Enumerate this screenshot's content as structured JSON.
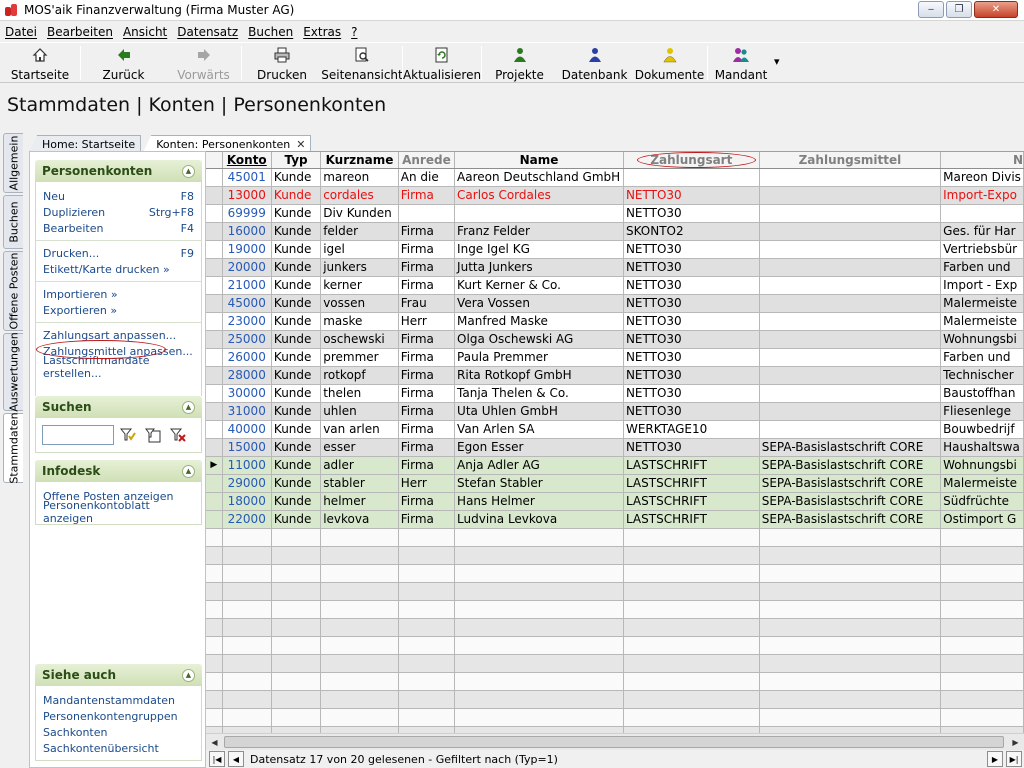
{
  "window": {
    "title": "MOS'aik Finanzverwaltung (Firma Muster AG)",
    "buttons": {
      "minimize": "‒",
      "maximize": "❐",
      "close": "✕"
    }
  },
  "menu": [
    "Datei",
    "Bearbeiten",
    "Ansicht",
    "Datensatz",
    "Buchen",
    "Extras",
    "?"
  ],
  "toolbar": {
    "startseite": "Startseite",
    "zurueck": "Zurück",
    "vorwaerts": "Vorwärts",
    "drucken": "Drucken",
    "seitenansicht": "Seitenansicht",
    "aktualisieren": "Aktualisieren",
    "projekte": "Projekte",
    "datenbank": "Datenbank",
    "dokumente": "Dokumente",
    "mandant": "Mandant",
    "more_arrow": "▾"
  },
  "heading": "Stammdaten | Konten | Personenkonten",
  "vertical_tabs": [
    "Allgemein",
    "Buchen",
    "Offene Posten",
    "Auswertungen",
    "Stammdaten"
  ],
  "doc_tabs": {
    "home": "Home: Startseite",
    "konten": "Konten: Personenkonten",
    "close": "✕"
  },
  "task_panel": {
    "personenkonten": {
      "title": "Personenkonten",
      "items": [
        {
          "label": "Neu",
          "shortcut": "F8"
        },
        {
          "label": "Duplizieren",
          "shortcut": "Strg+F8"
        },
        {
          "label": "Bearbeiten",
          "shortcut": "F4"
        },
        {
          "label": "Drucken...",
          "shortcut": "F9"
        },
        {
          "label": "Etikett/Karte drucken »",
          "shortcut": ""
        },
        {
          "label": "Importieren »",
          "shortcut": ""
        },
        {
          "label": "Exportieren »",
          "shortcut": ""
        },
        {
          "label": "Zahlungsart anpassen...",
          "shortcut": ""
        },
        {
          "label": "Zahlungsmittel anpassen...",
          "shortcut": ""
        },
        {
          "label": "Lastschriftmandate erstellen...",
          "shortcut": ""
        }
      ]
    },
    "suchen": {
      "title": "Suchen",
      "value": ""
    },
    "infodesk": {
      "title": "Infodesk",
      "items": [
        "Offene Posten anzeigen",
        "Personenkontoblatt anzeigen"
      ]
    },
    "siehe_auch": {
      "title": "Siehe auch",
      "items": [
        "Mandantenstammdaten",
        "Personenkontengruppen",
        "Sachkonten",
        "Sachkontenübersicht"
      ]
    }
  },
  "grid": {
    "columns": [
      "Konto",
      "Typ",
      "Kurzname",
      "Anrede",
      "Name",
      "Zahlungsart",
      "Zahlungsmittel",
      "N"
    ],
    "rows": [
      {
        "konto": "45001",
        "typ": "Kunde",
        "kurzname": "mareon",
        "anrede": "An die",
        "name": "Aareon Deutschland GmbH",
        "zahlungsart": "",
        "zahlungsmittel": "",
        "n": "Mareon Divis",
        "style": "white"
      },
      {
        "konto": "13000",
        "typ": "Kunde",
        "kurzname": "cordales",
        "anrede": "Firma",
        "name": "Carlos Cordales",
        "zahlungsart": "NETTO30",
        "zahlungsmittel": "",
        "n": "Import-Expo",
        "style": "gray",
        "red": true
      },
      {
        "konto": "69999",
        "typ": "Kunde",
        "kurzname": "Div Kunden",
        "anrede": "",
        "name": "",
        "zahlungsart": "NETTO30",
        "zahlungsmittel": "",
        "n": "",
        "style": "white"
      },
      {
        "konto": "16000",
        "typ": "Kunde",
        "kurzname": "felder",
        "anrede": "Firma",
        "name": "Franz Felder",
        "zahlungsart": "SKONTO2",
        "zahlungsmittel": "",
        "n": "Ges. für Har",
        "style": "gray"
      },
      {
        "konto": "19000",
        "typ": "Kunde",
        "kurzname": "igel",
        "anrede": "Firma",
        "name": "Inge Igel KG",
        "zahlungsart": "NETTO30",
        "zahlungsmittel": "",
        "n": "Vertriebsbür",
        "style": "white"
      },
      {
        "konto": "20000",
        "typ": "Kunde",
        "kurzname": "junkers",
        "anrede": "Firma",
        "name": "Jutta Junkers",
        "zahlungsart": "NETTO30",
        "zahlungsmittel": "",
        "n": "Farben und",
        "style": "gray"
      },
      {
        "konto": "21000",
        "typ": "Kunde",
        "kurzname": "kerner",
        "anrede": "Firma",
        "name": "Kurt Kerner & Co.",
        "zahlungsart": "NETTO30",
        "zahlungsmittel": "",
        "n": "Import - Exp",
        "style": "white"
      },
      {
        "konto": "45000",
        "typ": "Kunde",
        "kurzname": "vossen",
        "anrede": "Frau",
        "name": "Vera Vossen",
        "zahlungsart": "NETTO30",
        "zahlungsmittel": "",
        "n": "Malermeiste",
        "style": "gray"
      },
      {
        "konto": "23000",
        "typ": "Kunde",
        "kurzname": "maske",
        "anrede": "Herr",
        "name": "Manfred Maske",
        "zahlungsart": "NETTO30",
        "zahlungsmittel": "",
        "n": "Malermeiste",
        "style": "white"
      },
      {
        "konto": "25000",
        "typ": "Kunde",
        "kurzname": "oschewski",
        "anrede": "Firma",
        "name": "Olga Oschewski AG",
        "zahlungsart": "NETTO30",
        "zahlungsmittel": "",
        "n": "Wohnungsbi",
        "style": "gray"
      },
      {
        "konto": "26000",
        "typ": "Kunde",
        "kurzname": "premmer",
        "anrede": "Firma",
        "name": "Paula Premmer",
        "zahlungsart": "NETTO30",
        "zahlungsmittel": "",
        "n": "Farben und",
        "style": "white"
      },
      {
        "konto": "28000",
        "typ": "Kunde",
        "kurzname": "rotkopf",
        "anrede": "Firma",
        "name": "Rita Rotkopf GmbH",
        "zahlungsart": "NETTO30",
        "zahlungsmittel": "",
        "n": "Technischer",
        "style": "gray"
      },
      {
        "konto": "30000",
        "typ": "Kunde",
        "kurzname": "thelen",
        "anrede": "Firma",
        "name": "Tanja Thelen & Co.",
        "zahlungsart": "NETTO30",
        "zahlungsmittel": "",
        "n": "Baustoffhan",
        "style": "white"
      },
      {
        "konto": "31000",
        "typ": "Kunde",
        "kurzname": "uhlen",
        "anrede": "Firma",
        "name": "Uta Uhlen GmbH",
        "zahlungsart": "NETTO30",
        "zahlungsmittel": "",
        "n": "Fliesenlege",
        "style": "gray"
      },
      {
        "konto": "40000",
        "typ": "Kunde",
        "kurzname": "van arlen",
        "anrede": "Firma",
        "name": "Van Arlen SA",
        "zahlungsart": "WERKTAGE10",
        "zahlungsmittel": "",
        "n": "Bouwbedrijf",
        "style": "white"
      },
      {
        "konto": "15000",
        "typ": "Kunde",
        "kurzname": "esser",
        "anrede": "Firma",
        "name": "Egon Esser",
        "zahlungsart": "NETTO30",
        "zahlungsmittel": "SEPA-Basislastschrift CORE",
        "n": "Haushaltswa",
        "style": "gray"
      },
      {
        "konto": "11000",
        "typ": "Kunde",
        "kurzname": "adler",
        "anrede": "Firma",
        "name": "Anja Adler AG",
        "zahlungsart": "LASTSCHRIFT",
        "zahlungsmittel": "SEPA-Basislastschrift CORE",
        "n": "Wohnungsbi",
        "style": "green",
        "current": true
      },
      {
        "konto": "29000",
        "typ": "Kunde",
        "kurzname": "stabler",
        "anrede": "Herr",
        "name": "Stefan Stabler",
        "zahlungsart": "LASTSCHRIFT",
        "zahlungsmittel": "SEPA-Basislastschrift CORE",
        "n": "Malermeiste",
        "style": "green"
      },
      {
        "konto": "18000",
        "typ": "Kunde",
        "kurzname": "helmer",
        "anrede": "Firma",
        "name": "Hans Helmer",
        "zahlungsart": "LASTSCHRIFT",
        "zahlungsmittel": "SEPA-Basislastschrift CORE",
        "n": "Südfrüchte",
        "style": "green"
      },
      {
        "konto": "22000",
        "typ": "Kunde",
        "kurzname": "levkova",
        "anrede": "Firma",
        "name": "Ludvina Levkova",
        "zahlungsart": "LASTSCHRIFT",
        "zahlungsmittel": "SEPA-Basislastschrift CORE",
        "n": "Ostimport G",
        "style": "green"
      }
    ],
    "current_marker": "▶"
  },
  "status": {
    "text": "Datensatz 17 von 20 gelesenen - Gefiltert nach (Typ=1)"
  },
  "colors": {
    "accent_green": "#d8e8cc",
    "link_blue": "#2659b8",
    "error_red": "#e81010",
    "annotation_red": "#c01818"
  }
}
